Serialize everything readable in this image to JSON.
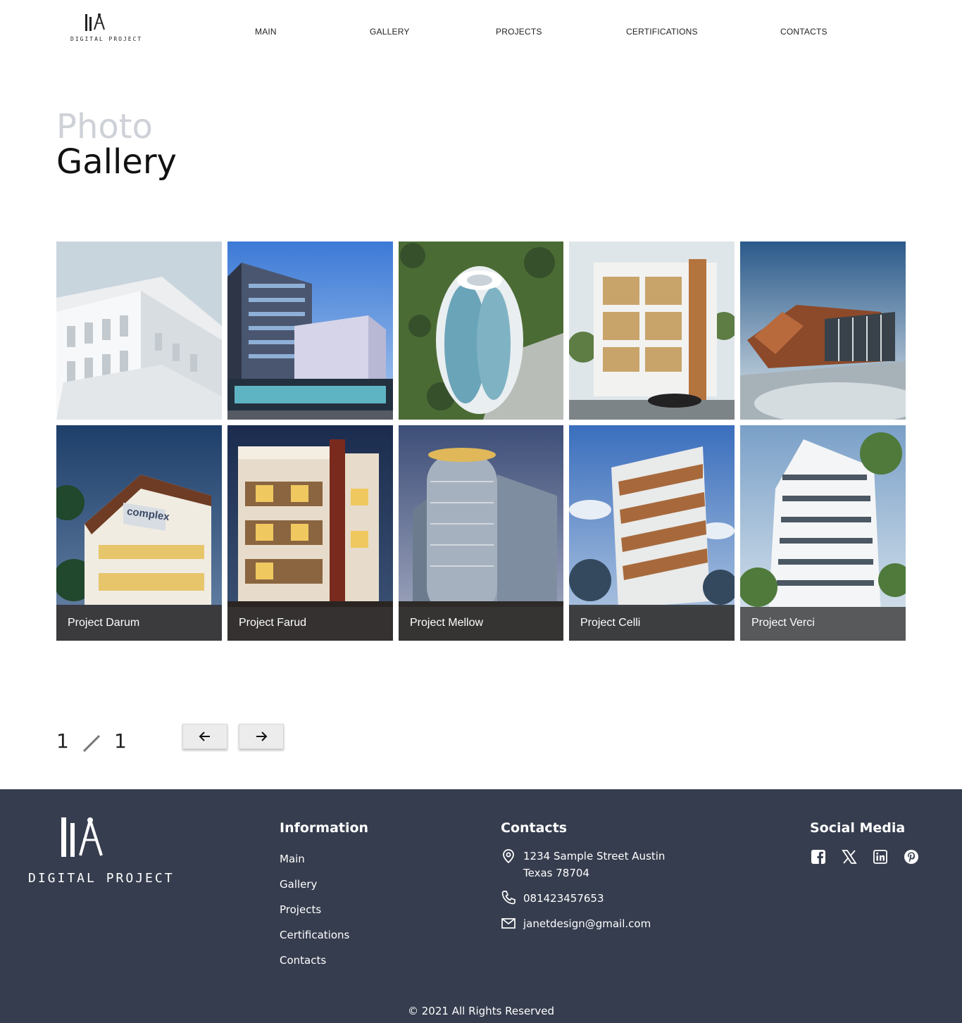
{
  "header": {
    "brand": "DIGITAL PROJECT",
    "nav": [
      {
        "label": "MAIN"
      },
      {
        "label": "GALLERY"
      },
      {
        "label": "PROJECTS"
      },
      {
        "label": "CERTIFICATIONS"
      },
      {
        "label": "CONTACTS"
      }
    ]
  },
  "page": {
    "title_light": "Photo",
    "title_dark": "Gallery"
  },
  "gallery": {
    "row2_captions": [
      "Project Darum",
      "Project Farud",
      "Project Mellow",
      "Project Celli",
      "Project Verci"
    ],
    "tile4_sign": "complex"
  },
  "pager": {
    "current": "1",
    "total": "1",
    "prev_icon": "arrow-left-icon",
    "next_icon": "arrow-right-icon"
  },
  "footer": {
    "brand": "DIGITAL PROJECT",
    "information": {
      "heading": "Information",
      "links": [
        "Main",
        "Gallery",
        "Projects",
        "Certifications",
        "Contacts"
      ]
    },
    "contacts": {
      "heading": "Contacts",
      "address_line1": "1234 Sample Street Austin",
      "address_line2": "Texas 78704",
      "phone": "081423457653",
      "email": "janetdesign@gmail.com"
    },
    "social": {
      "heading": "Social Media",
      "icons": [
        "facebook-icon",
        "x-icon",
        "linkedin-icon",
        "pinterest-icon"
      ]
    },
    "copyright": "© 2021 All Rights Reserved"
  },
  "colors": {
    "footer_bg": "#363d4e",
    "title_light": "#cfd1d8"
  }
}
